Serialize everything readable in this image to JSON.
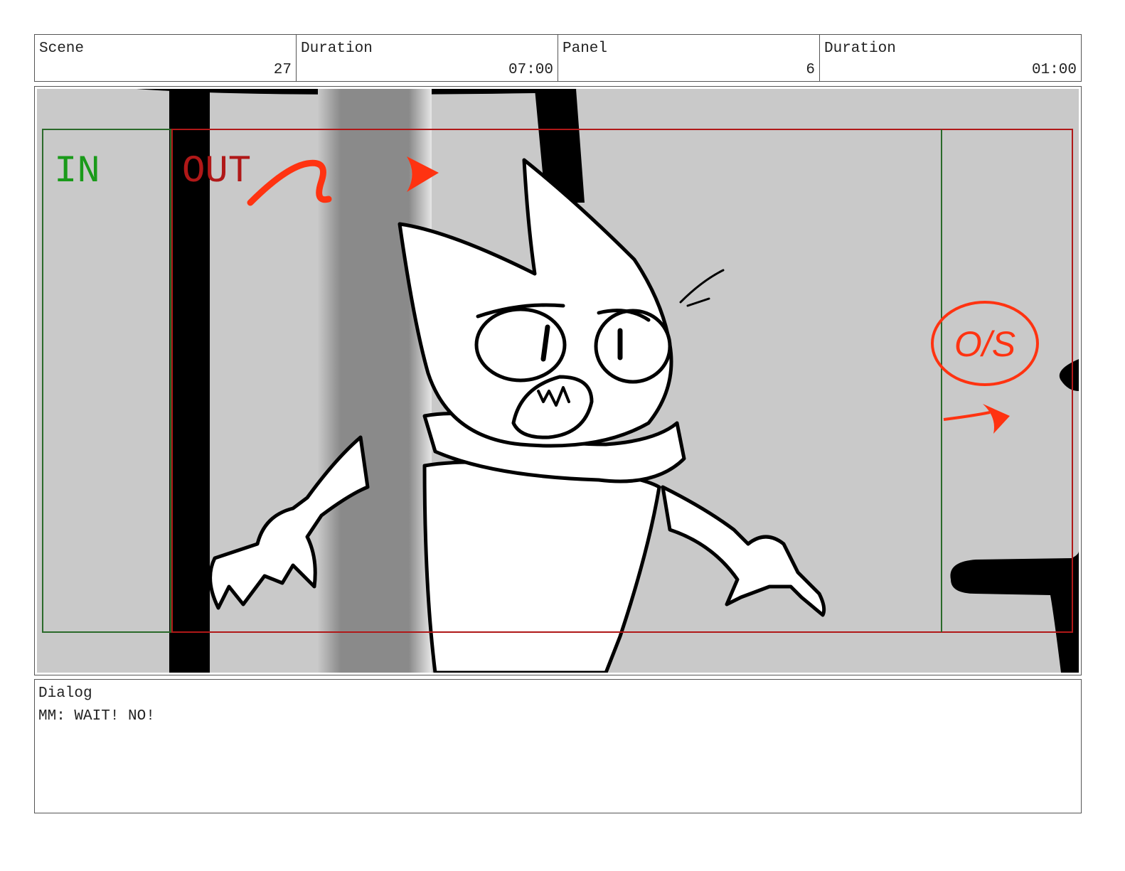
{
  "header": {
    "scene": {
      "label": "Scene",
      "value": "27"
    },
    "scene_duration": {
      "label": "Duration",
      "value": "07:00"
    },
    "panel": {
      "label": "Panel",
      "value": "6"
    },
    "panel_duration": {
      "label": "Duration",
      "value": "01:00"
    }
  },
  "frame": {
    "in_label": "IN",
    "out_label": "OUT",
    "os_label": "O/S",
    "colors": {
      "in": "#1a9a1a",
      "out": "#b01818",
      "annotation": "#ff3311"
    }
  },
  "dialog": {
    "label": "Dialog",
    "text": "MM: WAIT! NO!"
  }
}
